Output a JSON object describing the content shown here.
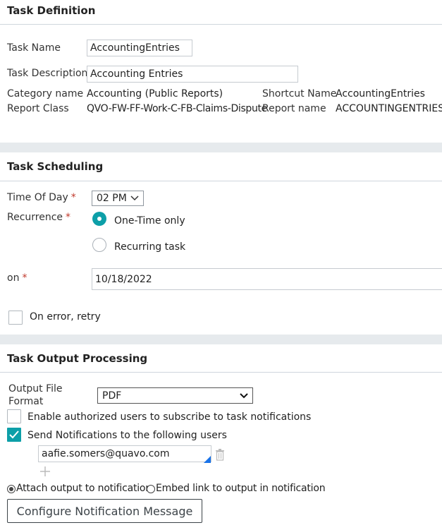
{
  "task_definition": {
    "title": "Task Definition",
    "task_name_label": "Task Name",
    "task_name_value": "AccountingEntries",
    "task_description_label": "Task Description",
    "task_description_value": "Accounting Entries",
    "category_name_label": "Category name",
    "category_name_value": "Accounting (Public Reports)",
    "shortcut_name_label": "Shortcut Name",
    "shortcut_name_value": "AccountingEntries",
    "report_class_label": "Report Class",
    "report_class_value": "QVO-FW-FF-Work-C-FB-Claims-Dispute",
    "report_name_label": "Report name",
    "report_name_value": "ACCOUNTINGENTRIES"
  },
  "task_scheduling": {
    "title": "Task Scheduling",
    "time_of_day_label": "Time Of Day",
    "time_of_day_value": "02 PM",
    "recurrence_label": "Recurrence",
    "required_mark": "*",
    "recurrence_options": [
      {
        "label": "One-Time only",
        "selected": true
      },
      {
        "label": "Recurring task",
        "selected": false
      }
    ],
    "on_label": "on",
    "on_value": "10/18/2022",
    "on_error_retry_label": "On error, retry",
    "on_error_retry_checked": false
  },
  "task_output": {
    "title": "Task Output Processing",
    "output_format_label_line1": "Output File",
    "output_format_label_line2": "Format",
    "output_format_value": "PDF",
    "subscribe_label": "Enable authorized users to subscribe to task notifications",
    "subscribe_checked": false,
    "send_notifications_label": "Send Notifications to the following users",
    "send_notifications_checked": true,
    "recipient_email": "aafie.somers@quavo.com",
    "attach_output_label": "Attach output to notification",
    "attach_output_selected": true,
    "embed_link_label": "Embed link to output in notification",
    "embed_link_selected": false,
    "configure_button_label": "Configure Notification Message"
  },
  "icons": {
    "check": "check-icon",
    "chevron": "chevron-down-icon",
    "trash": "trash-icon",
    "plus": "plus-icon"
  },
  "colors": {
    "accent": "#0d9fa8",
    "required": "#c0392b",
    "section_band": "#e6eaed",
    "lookup_corner": "#1a73e8"
  }
}
